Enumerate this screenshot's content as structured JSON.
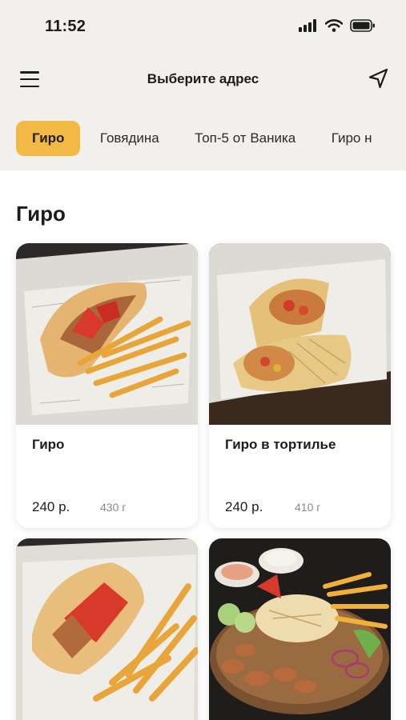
{
  "status_bar": {
    "time": "11:52"
  },
  "header": {
    "title": "Выберите адрес"
  },
  "tabs": [
    {
      "label": "Гиро"
    },
    {
      "label": "Говядина"
    },
    {
      "label": "Топ-5 от Ваника"
    },
    {
      "label": "Гиро н"
    }
  ],
  "section": {
    "title": "Гиро"
  },
  "products": [
    {
      "name": "Гиро",
      "price": "240 р.",
      "weight": "430 г"
    },
    {
      "name": "Гиро в тортилье",
      "price": "240 р.",
      "weight": "410 г"
    }
  ],
  "colors": {
    "accent": "#f2b945",
    "header_bg": "#f2f0ec"
  },
  "icons": [
    "signal-icon",
    "wifi-icon",
    "battery-icon",
    "menu-icon",
    "navigation-arrow-icon"
  ]
}
